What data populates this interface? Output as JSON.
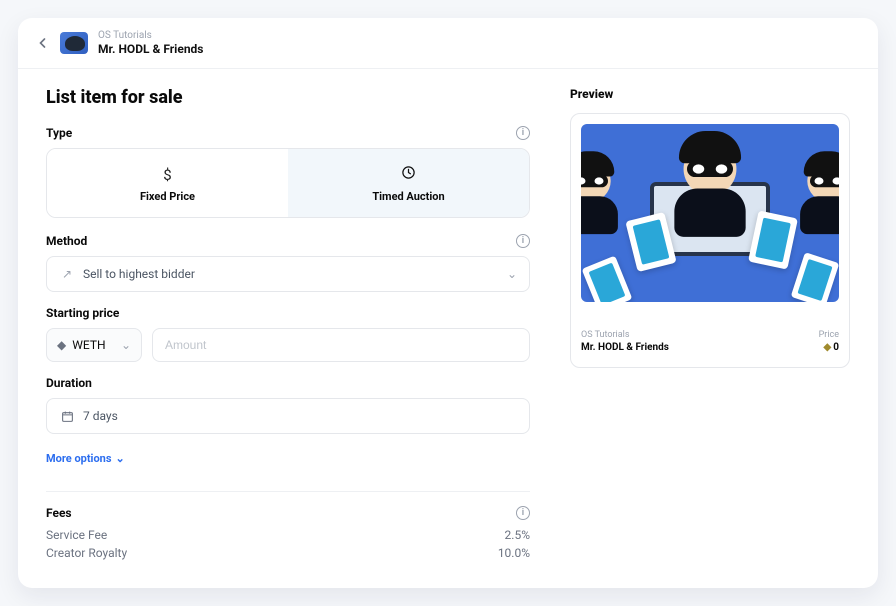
{
  "header": {
    "collection_label": "OS Tutorials",
    "item_name": "Mr. HODL & Friends"
  },
  "page": {
    "title": "List item for sale"
  },
  "type_section": {
    "label": "Type",
    "options": {
      "fixed": {
        "label": "Fixed Price"
      },
      "auction": {
        "label": "Timed Auction"
      }
    }
  },
  "method_section": {
    "label": "Method",
    "value": "Sell to highest bidder"
  },
  "price_section": {
    "label": "Starting price",
    "currency": "WETH",
    "amount_placeholder": "Amount"
  },
  "duration_section": {
    "label": "Duration",
    "value": "7 days"
  },
  "more": {
    "label": "More options"
  },
  "fees": {
    "label": "Fees",
    "service_label": "Service Fee",
    "service_value": "2.5%",
    "royalty_label": "Creator Royalty",
    "royalty_value": "10.0%"
  },
  "preview": {
    "label": "Preview",
    "collection_label": "OS Tutorials",
    "item_name": "Mr. HODL & Friends",
    "price_label": "Price",
    "price_value": "0"
  }
}
